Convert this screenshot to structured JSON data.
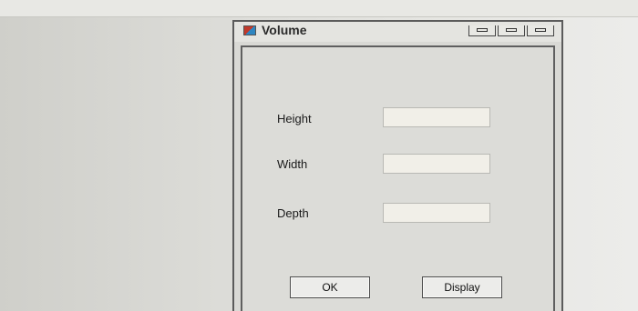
{
  "window": {
    "title": "Volume"
  },
  "form": {
    "height_label": "Height",
    "width_label": "Width",
    "depth_label": "Depth",
    "height_value": "",
    "width_value": "",
    "depth_value": ""
  },
  "buttons": {
    "ok_label": "OK",
    "display_label": "Display"
  }
}
